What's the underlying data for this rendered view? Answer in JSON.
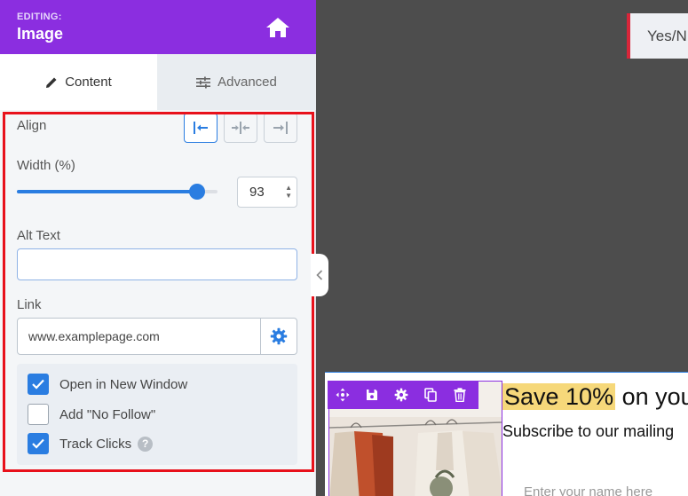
{
  "header": {
    "editing_label": "EDITING:",
    "title": "Image",
    "home_icon": "home-icon"
  },
  "tabs": [
    {
      "label": "Content",
      "icon": "pencil-icon",
      "active": true
    },
    {
      "label": "Advanced",
      "icon": "sliders-icon",
      "active": false
    }
  ],
  "align": {
    "label": "Align",
    "options": [
      "left",
      "center",
      "right"
    ],
    "selected": "left"
  },
  "width": {
    "label": "Width (%)",
    "value": 93,
    "slider_fraction": 0.9
  },
  "alt_text": {
    "label": "Alt Text",
    "value": ""
  },
  "link": {
    "label": "Link",
    "value": "www.examplepage.com",
    "settings_icon": "gear-icon"
  },
  "options": [
    {
      "label": "Open in New Window",
      "checked": true
    },
    {
      "label": "Add \"No Follow\"",
      "checked": false
    },
    {
      "label": "Track Clicks",
      "checked": true,
      "help": "?"
    }
  ],
  "canvas": {
    "yesno_label": "Yes/N",
    "headline_highlight": "Save 10%",
    "headline_rest": " on your",
    "subline": "Subscribe to our mailing",
    "name_placeholder": "Enter your name here"
  },
  "colors": {
    "brand_purple": "#8b2ee0",
    "accent_blue": "#2a7de1",
    "highlight_red": "#e8111b",
    "headline_highlight": "#f6d87a"
  }
}
